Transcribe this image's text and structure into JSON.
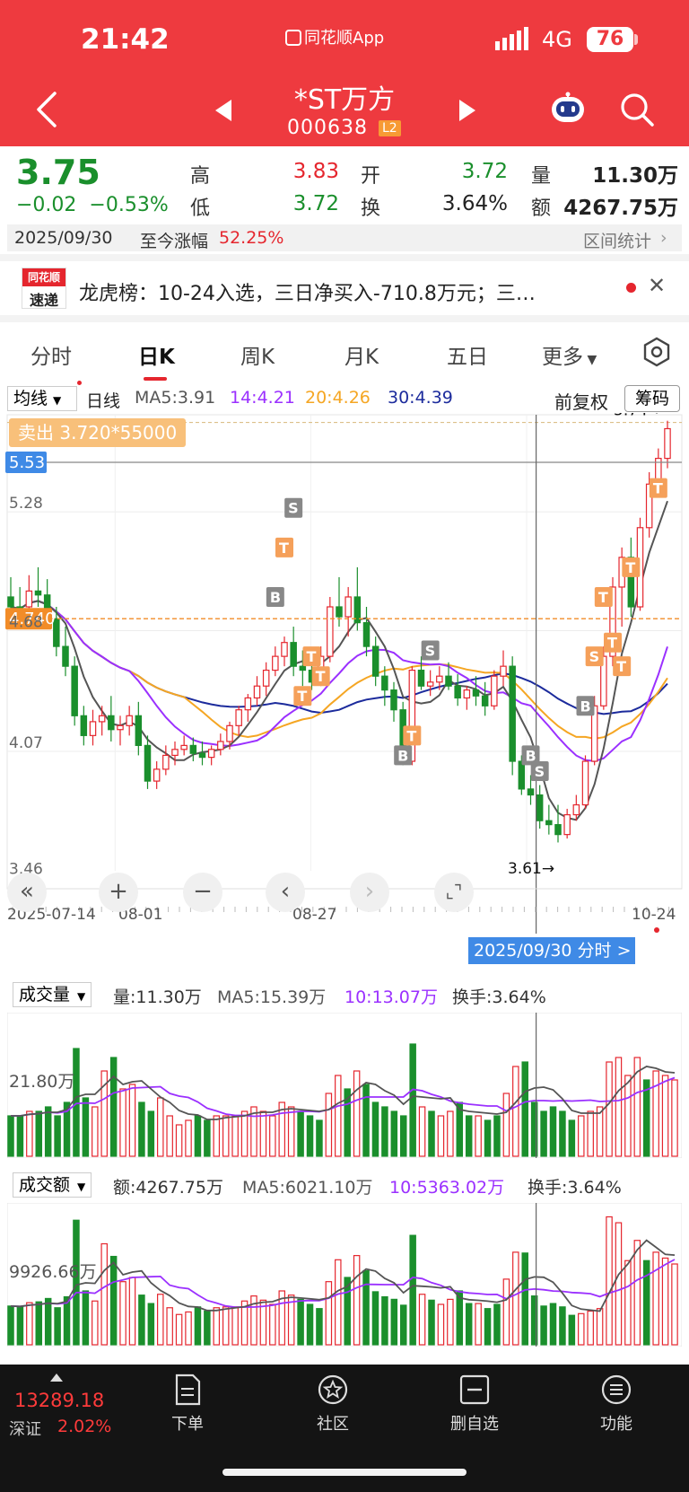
{
  "status_bar": {
    "time": "21:42",
    "app_indicator": "同花顺App",
    "network": "4G",
    "battery": "76"
  },
  "header": {
    "stock_name": "*ST万方",
    "stock_code": "000638",
    "level_badge": "L2"
  },
  "quote": {
    "price": "3.75",
    "change": "−0.02",
    "change_pct": "−0.53%",
    "high_label": "高",
    "high": "3.83",
    "open_label": "开",
    "open": "3.72",
    "volume_label": "量",
    "volume": "11.30万",
    "low_label": "低",
    "low": "3.72",
    "turnover_label": "换",
    "turnover": "3.64%",
    "amount_label": "额",
    "amount": "4267.75万"
  },
  "date_bar": {
    "date": "2025/09/30",
    "range_label": "至今涨幅",
    "range_value": "52.25%",
    "stats_link": "区间统计"
  },
  "news": {
    "logo_top": "同花顺",
    "logo_bottom": "速递",
    "text": "龙虎榜：10-24入选，三日净买入-710.8万元；三…"
  },
  "tabs": [
    "分时",
    "日K",
    "周K",
    "月K",
    "五日",
    "更多"
  ],
  "active_tab": "日K",
  "ma_legend": {
    "type": "均线",
    "period": "日线",
    "ma5": "MA5:3.91",
    "ma14": "14:4.21",
    "ma20": "20:4.26",
    "ma30": "30:4.39",
    "adjust": "前复权",
    "chips": "筹码"
  },
  "chart_labels": {
    "sell_tag": "卖出 3.720*55000",
    "high_mark": "5.74→",
    "low_mark": "3.61→",
    "price_cursor": "5.53",
    "ref_line": "4.740",
    "y_ticks": [
      "5.28",
      "4.68",
      "4.07",
      "3.46"
    ],
    "x_dates": [
      "2025-07-14",
      "08-01",
      "08-27",
      "10-24"
    ],
    "cursor_date": "2025/09/30 分时 >"
  },
  "volume_panel": {
    "type": "成交量",
    "vol": "量:11.30万",
    "ma5": "MA5:15.39万",
    "ma10": "10:13.07万",
    "turnover": "换手:3.64%",
    "y_tick": "21.80万"
  },
  "amount_panel": {
    "type": "成交额",
    "amt": "额:4267.75万",
    "ma5": "MA5:6021.10万",
    "ma10": "10:5363.02万",
    "turnover": "换手:3.64%",
    "y_tick": "9926.66万"
  },
  "bottom_bar": {
    "index_value": "13289.18",
    "index_name": "深证",
    "index_pct": "2.02%",
    "nav": [
      "下单",
      "社区",
      "删自选",
      "功能"
    ]
  },
  "colors": {
    "up": "#e5262e",
    "down": "#1a8f2c",
    "ma5": "#555555",
    "ma14": "#9b30ff",
    "ma20": "#f5a623",
    "ma30": "#1c2b9c",
    "header": "#ee3a3f"
  },
  "chart_data": {
    "type": "candlestick",
    "candles": [
      [
        4.85,
        4.95,
        4.72,
        4.8
      ],
      [
        4.8,
        4.9,
        4.7,
        4.78
      ],
      [
        4.8,
        4.96,
        4.74,
        4.88
      ],
      [
        4.88,
        5.0,
        4.8,
        4.86
      ],
      [
        4.86,
        4.94,
        4.7,
        4.74
      ],
      [
        4.74,
        4.8,
        4.55,
        4.6
      ],
      [
        4.6,
        4.7,
        4.45,
        4.5
      ],
      [
        4.5,
        4.55,
        4.2,
        4.25
      ],
      [
        4.25,
        4.3,
        4.1,
        4.15
      ],
      [
        4.15,
        4.28,
        4.1,
        4.22
      ],
      [
        4.22,
        4.3,
        4.15,
        4.25
      ],
      [
        4.25,
        4.35,
        4.12,
        4.18
      ],
      [
        4.18,
        4.25,
        4.1,
        4.2
      ],
      [
        4.2,
        4.3,
        4.15,
        4.25
      ],
      [
        4.25,
        4.32,
        4.05,
        4.1
      ],
      [
        4.1,
        4.15,
        3.88,
        3.92
      ],
      [
        3.92,
        4.02,
        3.88,
        3.98
      ],
      [
        3.98,
        4.1,
        3.95,
        4.05
      ],
      [
        4.05,
        4.12,
        4.0,
        4.08
      ],
      [
        4.08,
        4.15,
        4.05,
        4.1
      ],
      [
        4.1,
        4.14,
        4.02,
        4.06
      ],
      [
        4.06,
        4.12,
        4.0,
        4.04
      ],
      [
        4.04,
        4.1,
        4.0,
        4.08
      ],
      [
        4.08,
        4.16,
        4.05,
        4.12
      ],
      [
        4.12,
        4.22,
        4.08,
        4.2
      ],
      [
        4.2,
        4.3,
        4.15,
        4.28
      ],
      [
        4.28,
        4.36,
        4.22,
        4.34
      ],
      [
        4.34,
        4.45,
        4.3,
        4.4
      ],
      [
        4.4,
        4.52,
        4.35,
        4.48
      ],
      [
        4.48,
        4.6,
        4.45,
        4.55
      ],
      [
        4.55,
        4.65,
        4.5,
        4.62
      ],
      [
        4.62,
        4.7,
        4.45,
        4.5
      ],
      [
        4.5,
        4.58,
        4.4,
        4.48
      ],
      [
        4.48,
        4.55,
        4.38,
        4.42
      ],
      [
        4.42,
        4.6,
        4.4,
        4.55
      ],
      [
        4.55,
        4.85,
        4.52,
        4.8
      ],
      [
        4.8,
        4.95,
        4.7,
        4.75
      ],
      [
        4.75,
        4.9,
        4.65,
        4.85
      ],
      [
        4.85,
        5.0,
        4.68,
        4.72
      ],
      [
        4.72,
        4.8,
        4.55,
        4.6
      ],
      [
        4.6,
        4.65,
        4.4,
        4.45
      ],
      [
        4.45,
        4.5,
        4.3,
        4.38
      ],
      [
        4.38,
        4.42,
        4.22,
        4.28
      ],
      [
        4.28,
        4.32,
        4.0,
        4.02
      ],
      [
        4.02,
        4.5,
        4.0,
        4.48
      ],
      [
        4.48,
        4.55,
        4.38,
        4.4
      ],
      [
        4.4,
        4.48,
        4.35,
        4.42
      ],
      [
        4.42,
        4.5,
        4.38,
        4.45
      ],
      [
        4.45,
        4.52,
        4.38,
        4.4
      ],
      [
        4.4,
        4.46,
        4.3,
        4.34
      ],
      [
        4.34,
        4.4,
        4.28,
        4.38
      ],
      [
        4.38,
        4.45,
        4.3,
        4.35
      ],
      [
        4.35,
        4.42,
        4.25,
        4.3
      ],
      [
        4.3,
        4.48,
        4.28,
        4.45
      ],
      [
        4.45,
        4.58,
        4.4,
        4.5
      ],
      [
        4.5,
        4.55,
        3.95,
        4.02
      ],
      [
        4.02,
        4.05,
        3.85,
        3.88
      ],
      [
        3.88,
        3.95,
        3.8,
        3.85
      ],
      [
        3.85,
        3.9,
        3.68,
        3.72
      ],
      [
        3.72,
        3.8,
        3.65,
        3.7
      ],
      [
        3.7,
        3.8,
        3.61,
        3.65
      ],
      [
        3.65,
        3.78,
        3.63,
        3.75
      ],
      [
        3.75,
        3.85,
        3.72,
        3.8
      ],
      [
        3.8,
        4.05,
        3.78,
        4.02
      ],
      [
        4.02,
        4.35,
        4.0,
        4.3
      ],
      [
        4.3,
        4.6,
        4.28,
        4.55
      ],
      [
        4.55,
        4.95,
        4.5,
        4.9
      ],
      [
        4.9,
        5.1,
        4.7,
        5.05
      ],
      [
        5.05,
        5.15,
        4.75,
        4.8
      ],
      [
        4.8,
        5.25,
        4.78,
        5.2
      ],
      [
        5.2,
        5.48,
        5.15,
        5.42
      ],
      [
        5.42,
        5.6,
        5.38,
        5.55
      ],
      [
        5.55,
        5.74,
        5.5,
        5.7
      ]
    ],
    "volume_scale_max": 30,
    "volumes": [
      9,
      9,
      10,
      10,
      11,
      9,
      12,
      24,
      13,
      11,
      19,
      22,
      15,
      16,
      12,
      10,
      13,
      9,
      7,
      8,
      9,
      8,
      9,
      9,
      9,
      10,
      11,
      10,
      9,
      12,
      11,
      10,
      9,
      8,
      14,
      18,
      15,
      19,
      16,
      12,
      11,
      10,
      9,
      25,
      11,
      10,
      9,
      10,
      12,
      9,
      9,
      8,
      9,
      14,
      20,
      21,
      12,
      10,
      11,
      10,
      8,
      9,
      10,
      11,
      21,
      22,
      18,
      22,
      17,
      19,
      18,
      17
    ],
    "amount_scale_max": 16000,
    "amounts": [
      4600,
      4500,
      5000,
      5100,
      5500,
      4400,
      5700,
      14800,
      6400,
      5200,
      12000,
      10500,
      7500,
      8000,
      5900,
      4900,
      6000,
      4400,
      3600,
      3900,
      4500,
      4000,
      4400,
      4500,
      4500,
      5200,
      5800,
      5300,
      4800,
      6400,
      5900,
      5400,
      4800,
      4300,
      7500,
      10100,
      8000,
      10600,
      8800,
      6300,
      5700,
      5400,
      4700,
      13000,
      6000,
      5300,
      4800,
      5400,
      6400,
      4900,
      4900,
      4300,
      4800,
      7800,
      11000,
      10900,
      5800,
      4600,
      4900,
      4500,
      3500,
      3700,
      4000,
      4300,
      15200,
      14500,
      10000,
      12400,
      10000,
      11000,
      10300,
      9600
    ]
  }
}
